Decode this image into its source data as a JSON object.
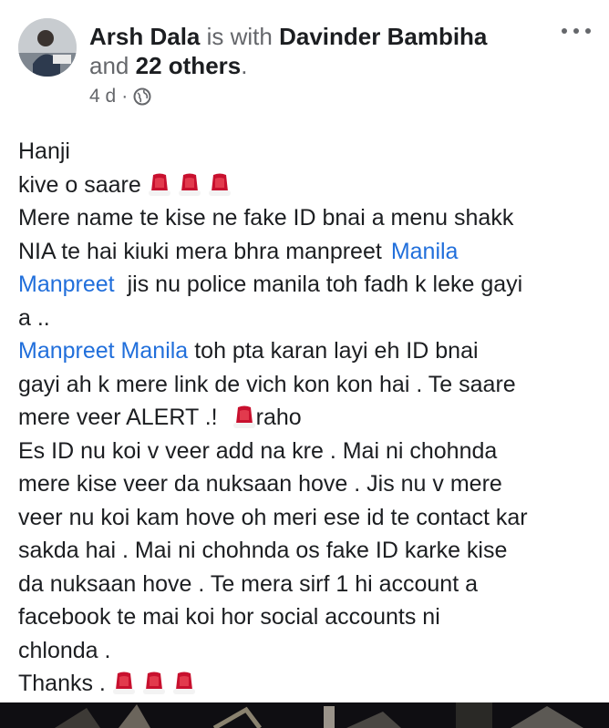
{
  "post": {
    "author": "Arsh Dala",
    "with_text": "is with",
    "tagged": "Davinder Bambiha",
    "and_text": "and",
    "others": "22 others",
    "period": ".",
    "time": "4 d",
    "dot": "·",
    "lines": {
      "l1": "Hanji",
      "l2": "kive o saare",
      "l3": "Mere name te kise ne fake ID bnai a menu shakk",
      "l4a": "NIA te hai kiuki mera bhra manpreet",
      "l4link": "Manila",
      "l5link": "Manpreet",
      "l5b": "jis nu police manila toh fadh k leke gayi",
      "l6": "a ..",
      "l7link": "Manpreet Manila",
      "l7b": "toh pta karan layi eh ID  bnai",
      "l8": "gayi ah k mere link de vich kon kon hai . Te saare",
      "l9a": "mere veer ALERT .!",
      "l9b": "raho",
      "l10": "Es ID nu koi v veer add na kre . Mai ni chohnda",
      "l11": "mere kise veer da nuksaan hove . Jis nu v mere",
      "l12": "veer nu koi kam hove oh meri ese id te contact kar",
      "l13": "sakda hai . Mai ni chohnda os fake ID karke kise",
      "l14": "da nuksaan hove . Te mera sirf 1 hi account a",
      "l15": "facebook te mai koi hor social accounts  ni",
      "l16": "chlonda .",
      "l17": "Thanks ."
    }
  },
  "icons": {
    "more": "more-options-icon",
    "privacy": "globe-icon",
    "emoji": "red-cap-emoji-icon"
  },
  "colors": {
    "link": "#216fdb",
    "meta": "#65676b",
    "text": "#1c1e21"
  }
}
